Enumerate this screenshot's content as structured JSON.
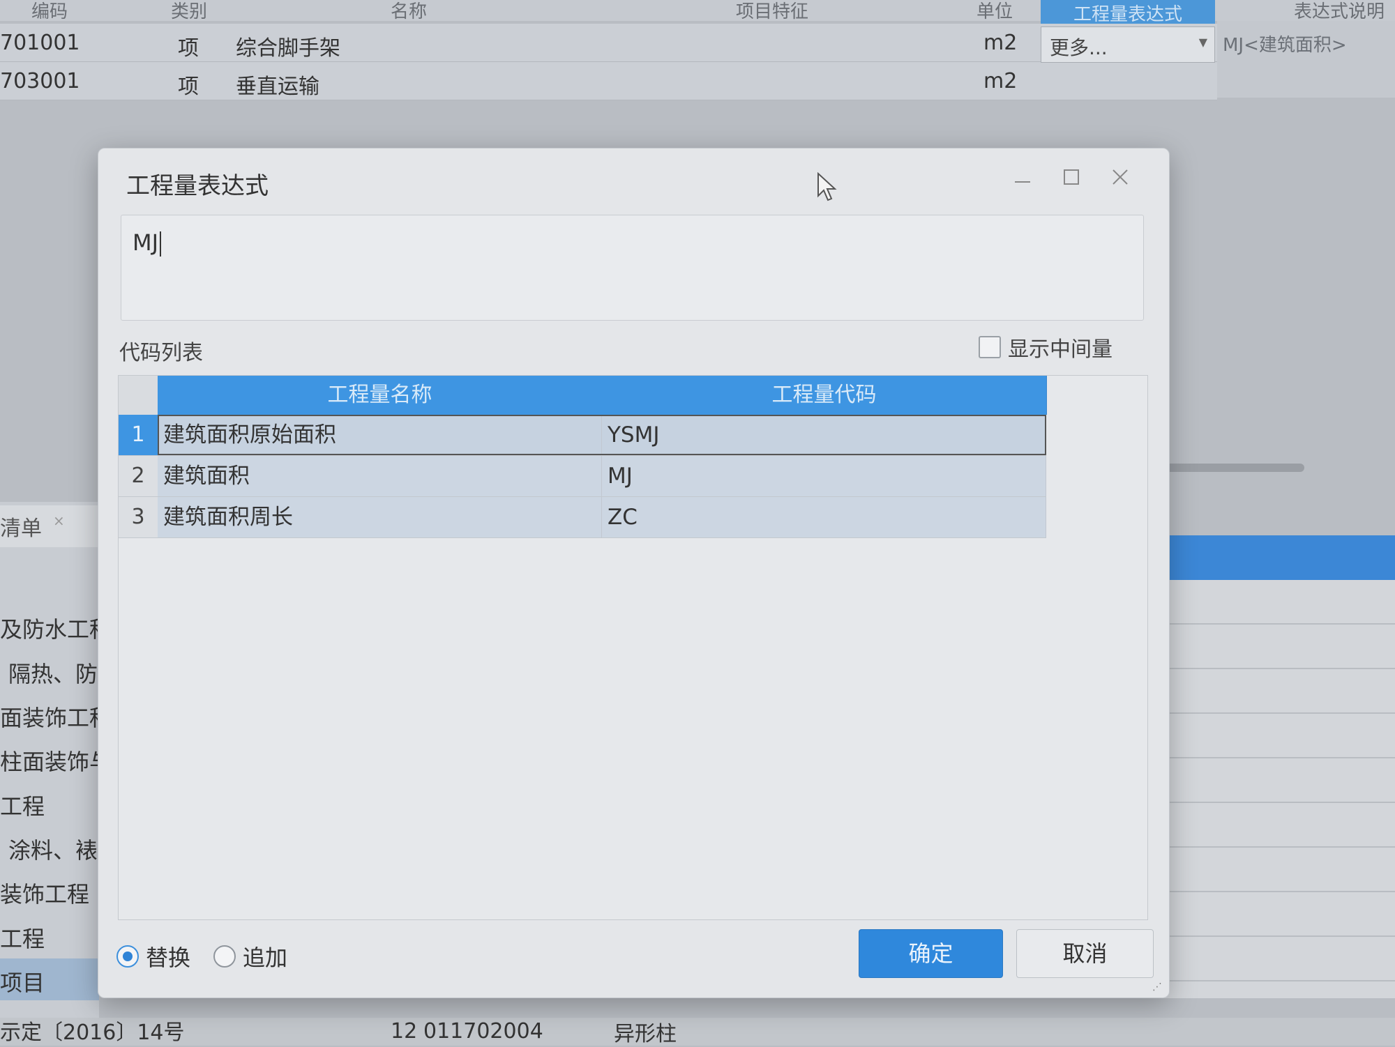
{
  "background": {
    "header": [
      "编码",
      "类别",
      "名称",
      "项目特征",
      "单位",
      "工程量表达式",
      "表达式说明"
    ],
    "rows": [
      {
        "code": "701001",
        "type": "项",
        "name": "综合脚手架",
        "unit": "m2"
      },
      {
        "code": "703001",
        "type": "项",
        "name": "垂直运输",
        "unit": "m2"
      }
    ],
    "combo_value": "更多...",
    "expr_desc": "MJ<建筑面积>",
    "tab_label": "清单",
    "tree_items": [
      "及防水工程",
      "隔热、防",
      "面装饰工程",
      "柱面装饰与",
      "工程",
      "涂料、裱",
      "装饰工程",
      "工程",
      "项目"
    ],
    "bottom_text": "示定〔2016〕14号",
    "bottom_row_num": "12",
    "bottom_row_code": "011702004",
    "bottom_row_name": "异形柱"
  },
  "dialog": {
    "title": "工程量表达式",
    "expression": "MJ",
    "code_list_label": "代码列表",
    "show_intermediate_label": "显示中间量",
    "columns": [
      "工程量名称",
      "工程量代码"
    ],
    "rows": [
      {
        "num": "1",
        "name": "建筑面积原始面积",
        "code": "YSMJ"
      },
      {
        "num": "2",
        "name": "建筑面积",
        "code": "MJ"
      },
      {
        "num": "3",
        "name": "建筑面积周长",
        "code": "ZC"
      }
    ],
    "radio_replace": "替换",
    "radio_append": "追加",
    "ok_label": "确定",
    "cancel_label": "取消"
  },
  "colors": {
    "accent": "#3e95e2",
    "button_primary": "#2f88dc"
  }
}
